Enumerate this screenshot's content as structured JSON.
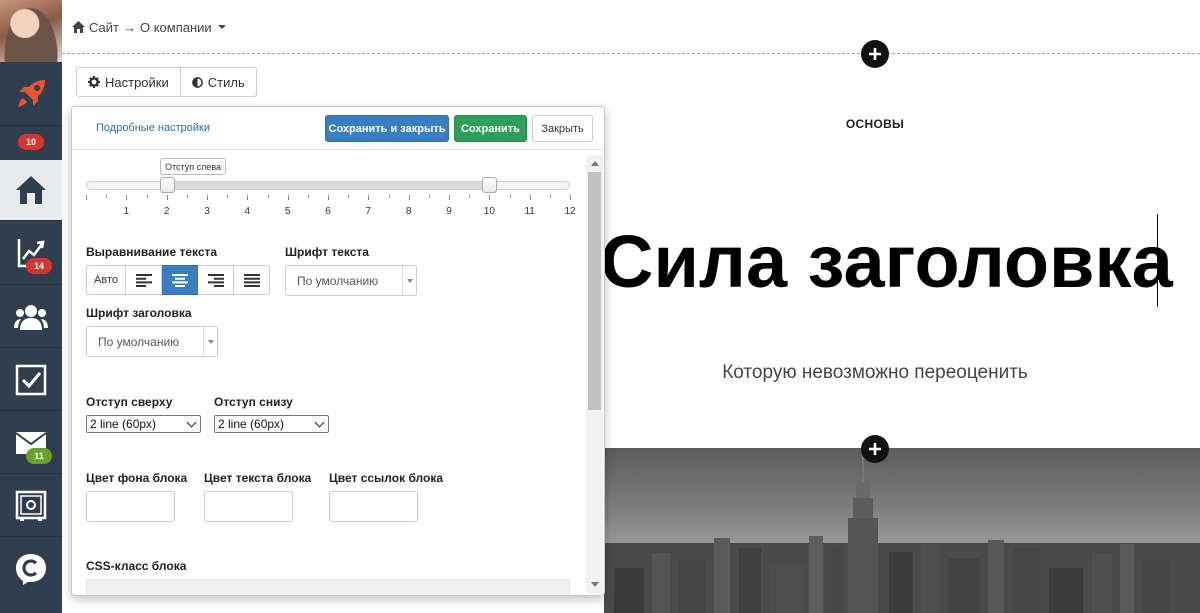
{
  "sidebar": {
    "avatar": "user-avatar",
    "items": [
      {
        "id": "rocket",
        "icon": "rocket-icon",
        "badge": ""
      },
      {
        "id": "home",
        "icon": "home-icon",
        "badge": "10"
      },
      {
        "id": "chart",
        "icon": "chart-icon",
        "badge": "14"
      },
      {
        "id": "users",
        "icon": "users-icon",
        "badge": ""
      },
      {
        "id": "tasks",
        "icon": "checkbox-icon",
        "badge": ""
      },
      {
        "id": "mail",
        "icon": "mail-icon",
        "badge": "11"
      },
      {
        "id": "safe",
        "icon": "safe-icon",
        "badge": ""
      },
      {
        "id": "brand",
        "icon": "brand-c-icon",
        "badge": ""
      }
    ],
    "colors": {
      "bg": "#2f3f4f",
      "badge_red": "#d9342b",
      "badge_green": "#6a9f2b",
      "accent": "#e8542d"
    }
  },
  "breadcrumb": {
    "site": "Сайт",
    "arrow": "→",
    "page": "О компании"
  },
  "tabs": [
    {
      "label": "Настройки",
      "icon": "gear-icon"
    },
    {
      "label": "Стиль",
      "icon": "contrast-icon"
    }
  ],
  "panel": {
    "advanced_link": "Подробные настройки",
    "save_close": "Сохранить и закрыть",
    "save": "Сохранить",
    "close": "Закрыть",
    "slider": {
      "tooltip": "Отступ слева",
      "min": 0,
      "max": 12,
      "value_left": 2,
      "value_right": 10,
      "tick_labels": [
        "1",
        "2",
        "3",
        "4",
        "5",
        "6",
        "7",
        "8",
        "9",
        "10",
        "11",
        "12"
      ]
    },
    "text_align": {
      "label": "Выравнивание текста",
      "options": [
        "Авто",
        "align-left-icon",
        "align-center-icon",
        "align-right-icon",
        "align-justify-icon"
      ],
      "auto_label": "Авто",
      "selected": "align-center-icon"
    },
    "text_font": {
      "label": "Шрифт текста",
      "value": "По умолчанию"
    },
    "heading_font": {
      "label": "Шрифт заголовка",
      "value": "По умолчанию"
    },
    "padding_top": {
      "label": "Отступ сверху",
      "value": "2 line (60px)"
    },
    "padding_bottom": {
      "label": "Отступ снизу",
      "value": "2 line (60px)"
    },
    "bg_color": {
      "label": "Цвет фона блока",
      "value": ""
    },
    "text_color": {
      "label": "Цвет текста блока",
      "value": ""
    },
    "link_color": {
      "label": "Цвет ссылок блока",
      "value": ""
    },
    "css_class": {
      "label": "CSS-класс блока",
      "value": ""
    },
    "colors": {
      "primary": "#3a7ec0",
      "success": "#2f9e5c"
    }
  },
  "preview": {
    "label": "ОСНОВЫ",
    "title": "Сила заголовка",
    "subtitle": "Которую невозможно переоценить"
  }
}
